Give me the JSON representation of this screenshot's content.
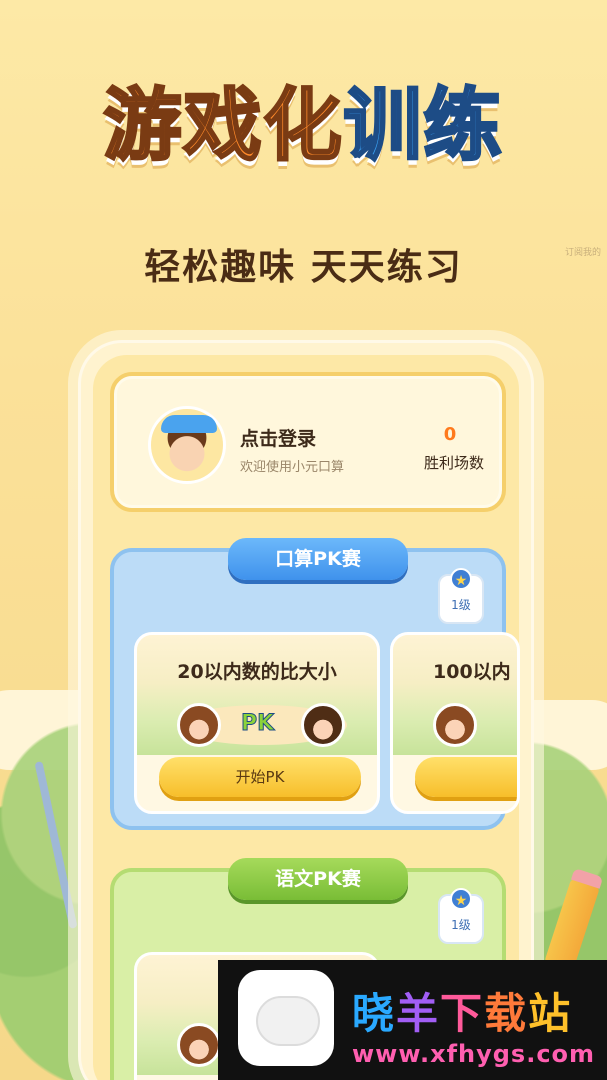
{
  "hero": {
    "title_part1": "游戏化",
    "title_part2": "训练",
    "subtitle": "轻松趣味 天天练习",
    "corner_text": "订阅我的"
  },
  "user_card": {
    "login_label": "点击登录",
    "welcome_text": "欢迎使用小元口算",
    "wins_count": "0",
    "wins_label": "胜利场数"
  },
  "sections": [
    {
      "title": "口算PK赛",
      "level": "1级",
      "games": [
        {
          "title": "20以内数的比大小",
          "start_label": "开始PK"
        },
        {
          "title": "100以内"
        }
      ]
    },
    {
      "title": "语文PK赛",
      "level": "1级"
    }
  ],
  "pk_mark": {
    "p": "P",
    "k": "K"
  },
  "watermark": {
    "name": "晓羊下载站",
    "chars": [
      "晓",
      "羊",
      "下",
      "载",
      "站"
    ],
    "url": "www.xfhygs.com"
  },
  "colors": {
    "background": "#fbe199",
    "accent_blue": "#3aa0f2",
    "accent_orange": "#ff8a2a",
    "wins_number": "#ff7a1d",
    "math_section": "#bcdcf7",
    "chinese_section": "#d9efa6",
    "start_button": "#f7be2a"
  }
}
